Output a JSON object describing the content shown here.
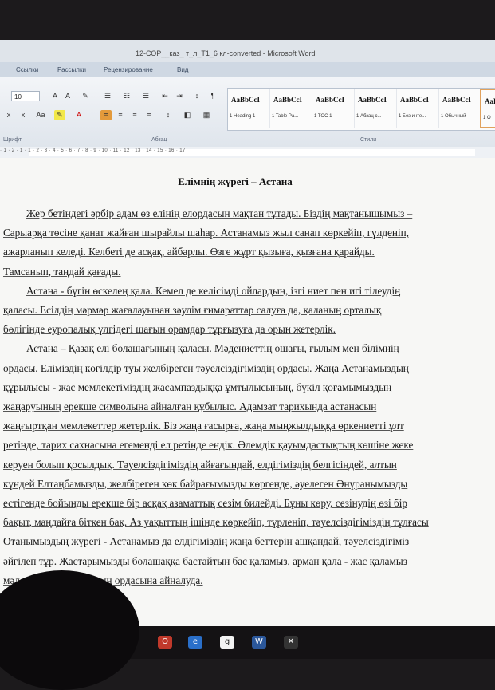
{
  "window": {
    "title": "12-СОР__каз_ т_л_Т1_6 кл-converted - Microsoft Word"
  },
  "ribbon_tabs": [
    "Ссылки",
    "Рассылки",
    "Рецензирование",
    "Вид"
  ],
  "font_group": {
    "font_size": "10",
    "label": "Шрифт"
  },
  "paragraph_group": {
    "label": "Абзац"
  },
  "styles_group": {
    "label": "Стили",
    "styles": [
      {
        "preview": "AaBbCcI",
        "name": "1 Heading 1"
      },
      {
        "preview": "AaBbCcI",
        "name": "1 Table Pa..."
      },
      {
        "preview": "AaBbCcI",
        "name": "1 TOC 1"
      },
      {
        "preview": "AaBbCcI",
        "name": "1 Абзац с..."
      },
      {
        "preview": "AaBbCcI",
        "name": "1 Без инте..."
      },
      {
        "preview": "AaBbCcI",
        "name": "1 Обычный"
      },
      {
        "preview": "AaB",
        "name": "1 О"
      }
    ]
  },
  "ruler": {
    "ticks": "· 1 · 2 · 1 · 1 · 2 · 3 · 4 · 5 · 6 · 7 · 8 · 9 · 10 · 11 · 12 · 13 · 14 · 15 · 16 · 17"
  },
  "document": {
    "title": "Елімнің жүрегі – Астана",
    "lines": [
      "Жер бетіндегі әрбір адам өз елінің елордасын мақтан тұтады. Біздің мақтанышымыз –",
      "Сарыарқа төсіне қанат жайған шырайлы шаһар. Астанамыз жыл санап көркейіп, гүлденіп,",
      "ажарланып келеді. Келбеті де асқақ, айбарлы. Өзге жұрт қызыға, қызғана қарайды.",
      "Тамсанып, таңдай қағады.",
      "Астана - бүгін өскелең қала. Кемел де келісімді ойлардың, ізгі ниет пен игі тілеудің",
      "қаласы. Есілдің мәрмәр жағалауынан зәулім ғимараттар салуға да, қаланың орталық",
      "бөлігінде еуропалық үлгідегі шағын орамдар тұрғызуға да орын жетерлік.",
      "Астана – Қазақ елі болашағының қаласы. Мәдениеттің ошағы, ғылым мен білімнің",
      "ордасы. Еліміздің көгілдір туы желбіреген тәуелсіздігіміздің ордасы. Жаңа Астанамыздың",
      "құрылысы - жас мемлекетіміздің жасампаздыққа ұмтылысының, бүкіл қоғамымыздың",
      "жаңаруының ерекше символына айналған құбылыс. Адамзат тарихында астанасын",
      "жаңғыртқан мемлекеттер жетерлік. Біз жаңа ғасырға, жаңа мыңжылдыққа өркениетті ұлт",
      "ретінде, тарих сахнасына егеменді ел ретінде ендік. Әлемдік қауымдастықтың көшіне жеке",
      "керуен болып қосылдық. Тәуелсіздігіміздің айғағындай, елдігіміздің белгісіндей, алтын",
      "күндей Елтаңбамызды, желбіреген көк байрағымызды көргенде, әуелеген Әнұранымызды",
      "естігенде бойынды ерекше бір асқақ азаматтық сезім билейді. Бұны көру, сезінудің өзі бір",
      "бақыт, маңдайға біткен бақ. Аз уақыттың ішінде көркейіп, түрленіп, тәуелсіздігіміздің тұлғасы",
      "Отанымыздың жүрегі - Астанамыз да елдігіміздің жаңа беттерін ашқандай, тәуелсіздігіміз",
      "әйгілеп тұр. Жастарымызды болашаққа бастайтын бас қаламыз, арман қала - жас қаламыз",
      "мәдениеттің, ғылымның ордасына айналуда."
    ]
  }
}
